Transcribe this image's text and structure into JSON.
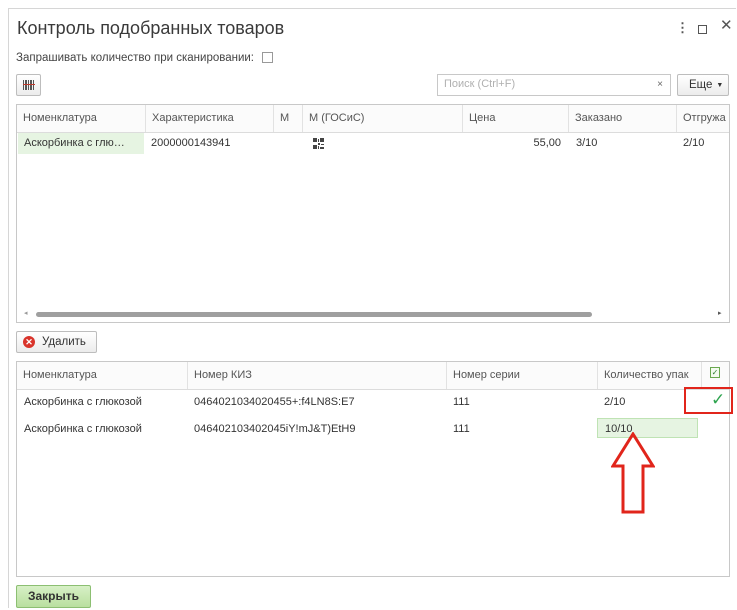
{
  "window": {
    "title": "Контроль подобранных товаров",
    "menu_icon": "more-vertical-icon",
    "maximize_icon": "maximize-icon",
    "close_icon": "close-icon"
  },
  "options": {
    "ask_quantity_label": "Запрашивать количество при сканировании:",
    "ask_quantity_checked": false
  },
  "toolbar": {
    "scan_icon": "barcode-scan-icon",
    "search_placeholder": "Поиск (Ctrl+F)",
    "search_clear": "×",
    "more_label": "Еще"
  },
  "goods_table": {
    "columns": [
      "Номенклатура",
      "Характеристика",
      "М",
      "М (ГОСиС)",
      "Цена",
      "Заказано",
      "Отгружа"
    ],
    "rows": [
      {
        "name": "Аскорбинка с глю…",
        "characteristic": "2000000143941",
        "m": "",
        "m_gosis_icon": "qr-code-icon",
        "price": "55,00",
        "ordered": "3/10",
        "shipped": "2/10"
      }
    ]
  },
  "delete_button": {
    "label": "Удалить",
    "icon": "delete-circle-icon"
  },
  "kiz_table": {
    "columns": [
      "Номенклатура",
      "Номер КИЗ",
      "Номер серии",
      "Количество упак"
    ],
    "header_check_icon": "checkbox-checked-icon",
    "rows": [
      {
        "name": "Аскорбинка с глюкозой",
        "kiz": "0464021034020455+:f4LN8S:E7",
        "series": "111",
        "qty": "2/10",
        "checked": true
      },
      {
        "name": "Аскорбинка с глюкозой",
        "kiz": "046402103402045iY!mJ&T)EtH9",
        "series": "111",
        "qty": "10/10",
        "checked": false
      }
    ]
  },
  "annotations": {
    "highlight_color": "#e1251b",
    "check_icon": "checkmark-icon"
  },
  "footer": {
    "close_label": "Закрыть"
  }
}
